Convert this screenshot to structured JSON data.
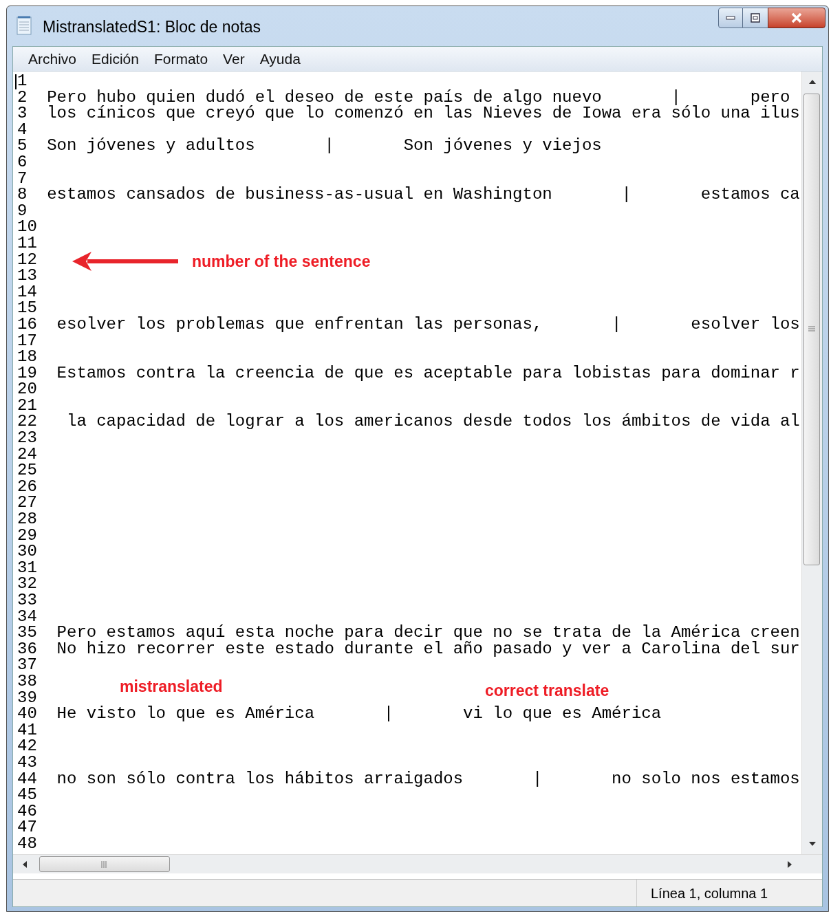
{
  "window": {
    "title": "MistranslatedS1: Bloc de notas"
  },
  "menu": [
    "Archivo",
    "Edición",
    "Formato",
    "Ver",
    "Ayuda"
  ],
  "lines": [
    {
      "number": "1"
    },
    {
      "number": "2",
      "text": "Pero hubo quien dudó el deseo de este país de algo nuevo       |       pero"
    },
    {
      "number": "3",
      "text": "los cínicos que creyó que lo comenzó en las Nieves de Iowa era sólo una ilus"
    },
    {
      "number": "4"
    },
    {
      "number": "5",
      "text": "Son jóvenes y adultos       |       Son jóvenes y viejos"
    },
    {
      "number": "6"
    },
    {
      "number": "7"
    },
    {
      "number": "8",
      "text": "estamos cansados de business-as-usual en Washington       |       estamos ca"
    },
    {
      "number": "9"
    },
    {
      "number": "10"
    },
    {
      "number": "11"
    },
    {
      "number": "12"
    },
    {
      "number": "13"
    },
    {
      "number": "14"
    },
    {
      "number": "15"
    },
    {
      "number": "16",
      "text": " esolver los problemas que enfrentan las personas,       |       esolver los"
    },
    {
      "number": "17"
    },
    {
      "number": "18"
    },
    {
      "number": "19",
      "text": " Estamos contra la creencia de que es aceptable para lobistas para dominar r"
    },
    {
      "number": "20"
    },
    {
      "number": "21"
    },
    {
      "number": "22",
      "text": "  la capacidad de lograr a los americanos desde todos los ámbitos de vida al"
    },
    {
      "number": "23"
    },
    {
      "number": "24"
    },
    {
      "number": "25"
    },
    {
      "number": "26"
    },
    {
      "number": "27"
    },
    {
      "number": "28"
    },
    {
      "number": "29"
    },
    {
      "number": "30"
    },
    {
      "number": "31"
    },
    {
      "number": "32"
    },
    {
      "number": "33"
    },
    {
      "number": "34"
    },
    {
      "number": "35",
      "text": " Pero estamos aquí esta noche para decir que no se trata de la América creen"
    },
    {
      "number": "36",
      "text": " No hizo recorrer este estado durante el año pasado y ver a Carolina del sur"
    },
    {
      "number": "37"
    },
    {
      "number": "38"
    },
    {
      "number": "39"
    },
    {
      "number": "40",
      "text": " He visto lo que es América       |       vi lo que es América"
    },
    {
      "number": "41"
    },
    {
      "number": "42"
    },
    {
      "number": "43"
    },
    {
      "number": "44",
      "text": " no son sólo contra los hábitos arraigados       |       no solo nos estamos"
    },
    {
      "number": "45"
    },
    {
      "number": "46"
    },
    {
      "number": "47"
    },
    {
      "number": "48"
    }
  ],
  "annotations": [
    {
      "kind": "arrow",
      "text": "number of the sentence"
    },
    {
      "kind": "label",
      "text": "mistranslated"
    },
    {
      "kind": "label",
      "text": "correct translate"
    }
  ],
  "status_bar": {
    "position": "Línea 1, columna 1"
  }
}
